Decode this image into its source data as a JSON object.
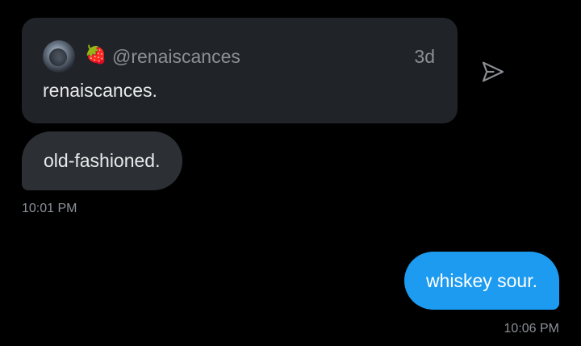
{
  "quoted_post": {
    "handle": "@renaiscances",
    "emoji": "🍓",
    "age": "3d",
    "text": "renaiscances."
  },
  "messages": [
    {
      "direction": "incoming",
      "text": "old-fashioned.",
      "time": "10:01 PM"
    },
    {
      "direction": "outgoing",
      "text": "whiskey sour.",
      "time": "10:06 PM"
    }
  ],
  "icons": {
    "share": "send-icon"
  },
  "colors": {
    "background": "#000000",
    "card": "#202327",
    "incoming_bubble": "#2c3034",
    "outgoing_bubble": "#1d9bf0",
    "muted_text": "#8b9097",
    "primary_text": "#e7e9ea"
  }
}
